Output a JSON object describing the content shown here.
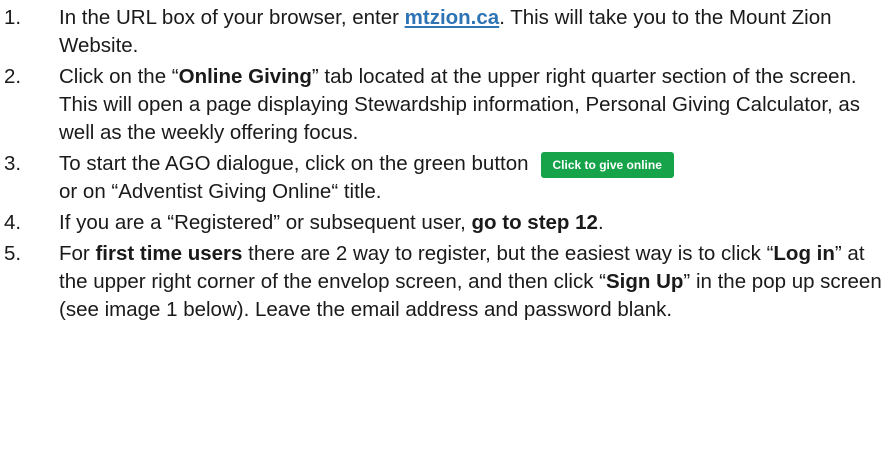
{
  "steps": [
    {
      "number": "1.",
      "t1": "In the URL box of your browser, enter ",
      "link": "mtzion.ca",
      "t2": ". This will take you to the Mount Zion Website."
    },
    {
      "number": "2.",
      "t1": "Click on the “",
      "b1": "Online Giving",
      "t2": "” tab located at the upper right quarter section of the screen. This will open a page displaying Stewardship information, Personal Giving Calculator, as well as the weekly offering focus."
    },
    {
      "number": "3.",
      "t1": "To start the AGO dialogue, click on the green button",
      "button_label": "Click to give  online",
      "t2": " or on “Adventist Giving Online“ title."
    },
    {
      "number": "4.",
      "t1": "If you are a “Registered” or subsequent user, ",
      "b1": "go to step 12",
      "t2": "."
    },
    {
      "number": "5.",
      "t1": "For ",
      "b1": "first time users",
      "t2": " there are 2 way to register, but the easiest way is to click “",
      "b2": "Log in",
      "t3": "” at the upper right corner of the envelop screen, and then click “",
      "b3": "Sign Up",
      "t4": "” in the pop up screen (see image 1 below). Leave the email address and password blank."
    }
  ]
}
